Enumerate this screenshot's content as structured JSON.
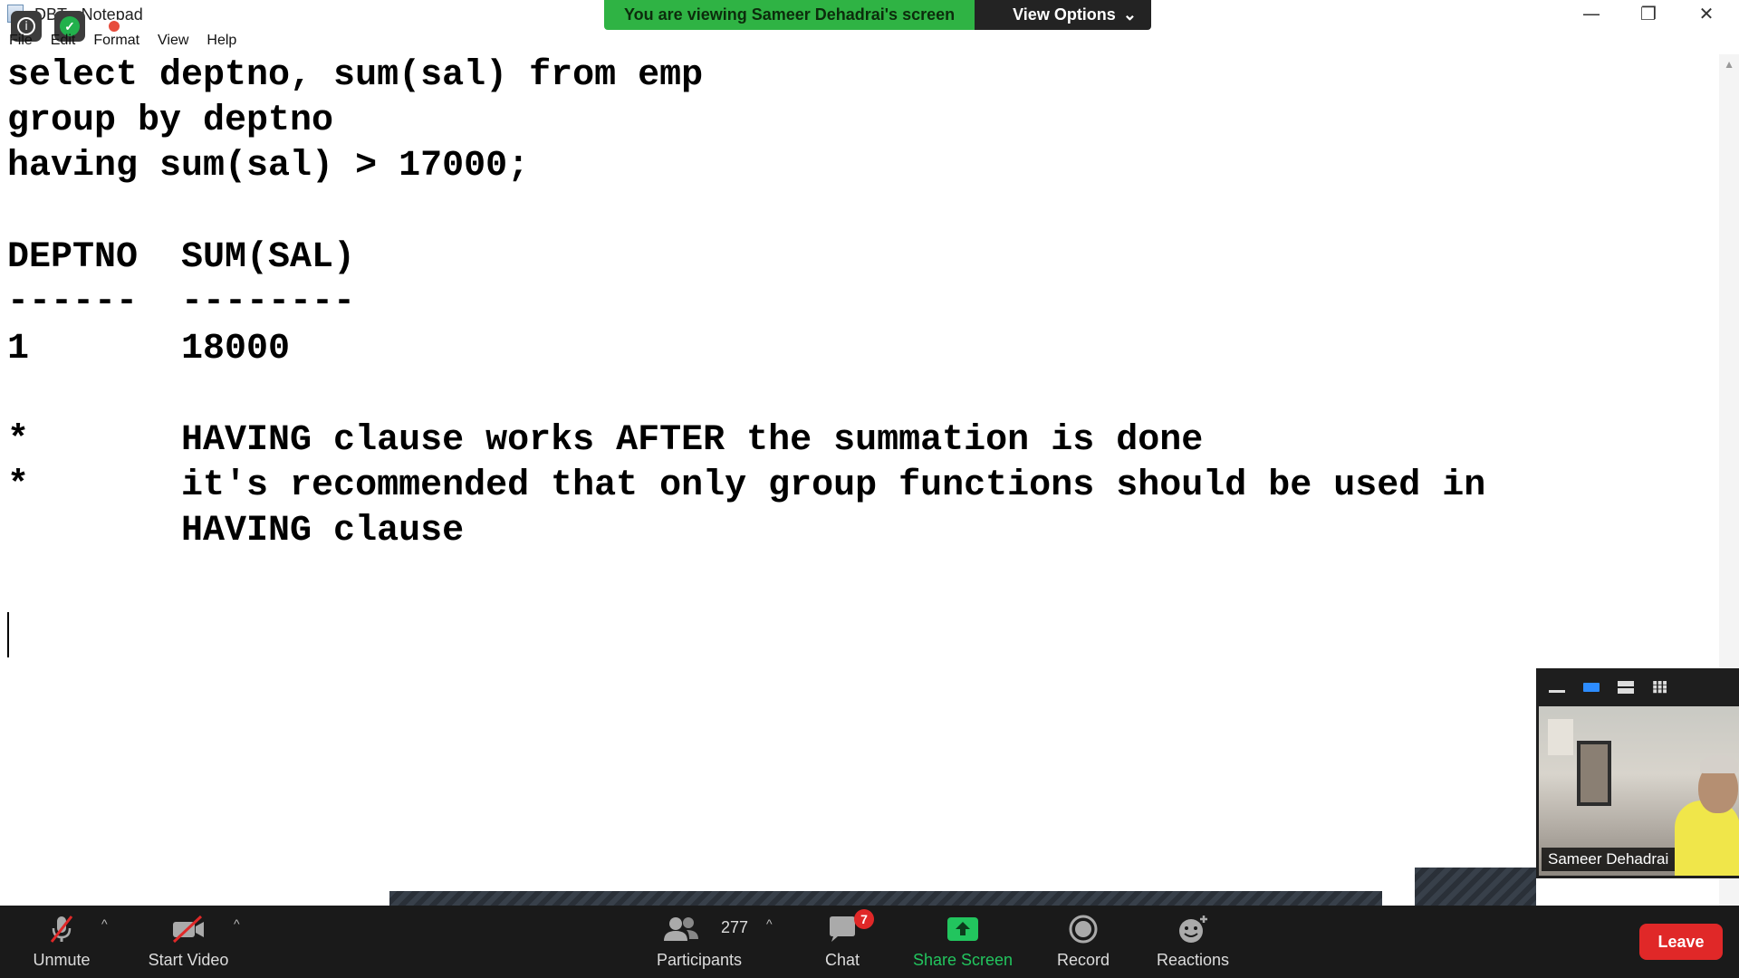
{
  "window": {
    "title": "DBT - Notepad",
    "menu": [
      "File",
      "Edit",
      "Format",
      "View",
      "Help"
    ],
    "controls": {
      "minimize": "—",
      "restore": "❐",
      "close": "✕"
    }
  },
  "banner": {
    "text": "You are viewing Sameer Dehadrai's screen",
    "view_options": "View Options",
    "chevron": "⌄"
  },
  "editor": {
    "lines": [
      "select deptno, sum(sal) from emp",
      "group by deptno",
      "having sum(sal) > 17000;",
      "DEPTNO  SUM(SAL)",
      "------  --------",
      "1       18000",
      "*       HAVING clause works AFTER the summation is done",
      "*       it's recommended that only group functions should be used in",
      "        HAVING clause"
    ]
  },
  "video": {
    "participant_name": "Sameer Dehadrai"
  },
  "toolbar": {
    "unmute": "Unmute",
    "start_video": "Start Video",
    "participants": "Participants",
    "participants_count": "277",
    "chat": "Chat",
    "chat_badge": "7",
    "share_screen": "Share Screen",
    "record": "Record",
    "reactions": "Reactions",
    "leave": "Leave",
    "caret": "^"
  },
  "colors": {
    "banner_green": "#2fb344",
    "share_green": "#22c55e",
    "leave_red": "#e02828",
    "toolbar_bg": "#1a1a1a"
  }
}
